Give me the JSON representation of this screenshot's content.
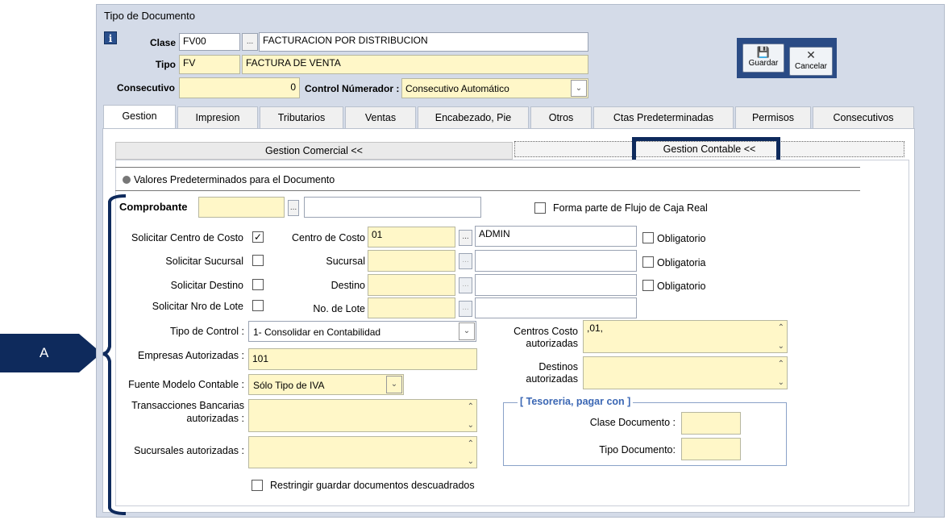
{
  "window": {
    "title": "Tipo de Documento"
  },
  "header": {
    "clase_label": "Clase",
    "clase_code": "FV00",
    "clase_desc": "FACTURACION POR DISTRIBUCION",
    "tipo_label": "Tipo",
    "tipo_code": "FV",
    "tipo_desc": "FACTURA DE VENTA",
    "consecutivo_label": "Consecutivo",
    "consecutivo_value": "0",
    "control_label": "Control Númerador :",
    "control_value": "Consecutivo Automático",
    "dots": "..."
  },
  "toolbar": {
    "guardar": "Guardar",
    "cancelar": "Cancelar"
  },
  "tabs": [
    "Gestion",
    "Impresion",
    "Tributarios",
    "Ventas",
    "Encabezado, Pie",
    "Otros",
    "Ctas Predeterminadas",
    "Permisos",
    "Consecutivos"
  ],
  "subtabs": {
    "comercial": "Gestion Comercial <<",
    "contable": "Gestion Contable <<"
  },
  "section": {
    "valores": "Valores Predeterminados para el Documento"
  },
  "comprobante": {
    "label": "Comprobante",
    "flujo": "Forma parte de Flujo de Caja  Real"
  },
  "rows": {
    "solicitar_centro": "Solicitar Centro de Costo",
    "solicitar_sucursal": "Solicitar Sucursal",
    "solicitar_destino": "Solicitar Destino",
    "solicitar_lote": "Solicitar Nro de  Lote",
    "centro_label": "Centro de Costo",
    "centro_code": "01",
    "centro_desc": "ADMIN",
    "sucursal_label": "Sucursal",
    "destino_label": "Destino",
    "lote_label": "No. de Lote",
    "obligatorio": "Obligatorio",
    "obligatoria": "Obligatoria"
  },
  "form": {
    "tipo_control_label": "Tipo de Control :",
    "tipo_control_value": "1- Consolidar en Contabilidad",
    "empresas_label": "Empresas Autorizadas :",
    "empresas_value": "101",
    "fuente_label": "Fuente Modelo Contable :",
    "fuente_value": "Sólo Tipo de IVA",
    "transacciones_label1": "Transacciones Bancarias",
    "transacciones_label2": "autorizadas :",
    "sucursales_label": "Sucursales autorizadas :",
    "centros_label1": "Centros Costo",
    "centros_label2": "autorizadas",
    "centros_value": ",01,",
    "destinos_label1": "Destinos",
    "destinos_label2": "autorizadas",
    "restringir": "Restringir guardar documentos descuadrados"
  },
  "tesoreria": {
    "title": "[ Tesoreria, pagar con ]",
    "clase": "Clase Documento :",
    "tipo": "Tipo Documento:"
  },
  "annotation": {
    "label": "A"
  },
  "colors": {
    "annotation_bg": "#0e2a5c",
    "highlight_box": "#0e2a5c",
    "field_yellow": "#fff7c8"
  }
}
